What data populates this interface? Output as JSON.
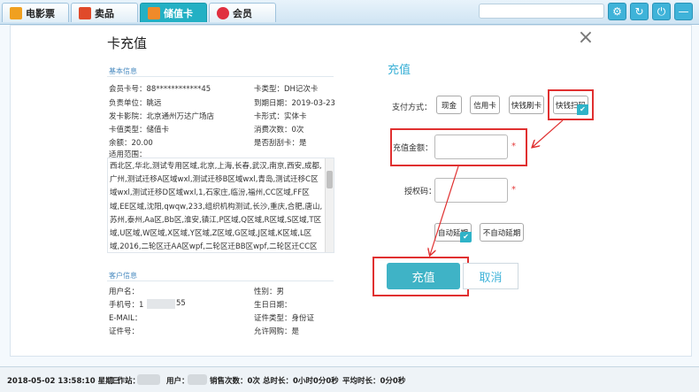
{
  "tabs": [
    {
      "label": "电影票",
      "icon": "movie-ticket-icon",
      "color": "#f0a020"
    },
    {
      "label": "卖品",
      "icon": "popcorn-icon",
      "color": "#e04a2a"
    },
    {
      "label": "储值卡",
      "icon": "card-icon",
      "color": "#f08a2a"
    },
    {
      "label": "会员",
      "icon": "heart-icon",
      "color": "#e03040"
    }
  ],
  "toolbar_icons": [
    "settings-icon",
    "refresh-icon",
    "power-icon",
    "minimize-icon"
  ],
  "dialog": {
    "title": "卡充值",
    "close": "×"
  },
  "basic": {
    "section": "基本信息",
    "card_no": "会员卡号：88************45",
    "card_type": "卡类型：DH记次卡",
    "unit": "负责单位：眺远",
    "expire": "到期日期：2019-03-23",
    "issuer": "发卡影院：北京通州万达广场店",
    "form": "卡形式：实体卡",
    "kind": "卡值类型：储值卡",
    "consume": "消费次数：0次",
    "balance": "余额：20.00",
    "scan": "是否刮刮卡：是",
    "scope_label": "适用范围：",
    "scope_text": "西北区,华北,测试专用区域,北京,上海,长春,武汉,南京,西安,成都,广州,测试迁移A区域wxl,测试迁移B区域wxl,青岛,测试迁移C区域wxl,测试迁移D区域wxl,1,石家庄,临汾,福州,CC区域,FF区域,EE区域,沈阳,qwqw,233,组织机构测试,长沙,重庆,合肥,唐山,苏州,泰州,Aa区,Bb区,淮安,镇江,P区域,Q区域,R区域,S区域,T区域,U区域,W区域,X区域,Y区域,Z区域,G区域,J区域,K区域,L区域,2016,二轮区迁AA区wpf,二轮区迁BB区wpf,二轮区迁CC区wpf,区域迁移A区wpf,区域迁移B区wpf,区"
  },
  "customer": {
    "section": "客户信息",
    "name": "用户名：",
    "gender": "性别：男",
    "phone_prefix": "手机号：1",
    "phone_suffix": "55",
    "birthday": "生日日期：",
    "email": "E-MAIL：",
    "id_type": "证件类型：身份证",
    "id_no": "证件号：",
    "online": "允许网购：是"
  },
  "form": {
    "title": "充值",
    "pay_label": "支付方式：",
    "pay_methods": [
      {
        "label": "现金",
        "checked": false
      },
      {
        "label": "信用卡",
        "checked": false
      },
      {
        "label": "快钱刷卡",
        "checked": false
      },
      {
        "label": "快钱扫码",
        "checked": true
      }
    ],
    "amount_label": "充值金额：",
    "auth_label": "授权码：",
    "required_mark": "*",
    "auto_extend": "自动延期",
    "no_auto_extend": "不自动延期",
    "submit": "充值",
    "cancel": "取消"
  },
  "status": {
    "datetime": "2018-05-02 13:58:10 星期三",
    "station": "工作站：",
    "user": "用户：",
    "sales": "销售次数：0次",
    "total": "总时长：0小时0分0秒",
    "avg": "平均时长：0分0秒"
  },
  "colors": {
    "accent": "#3fb3c6",
    "highlight": "#e03030",
    "section": "#4a8bc0"
  }
}
